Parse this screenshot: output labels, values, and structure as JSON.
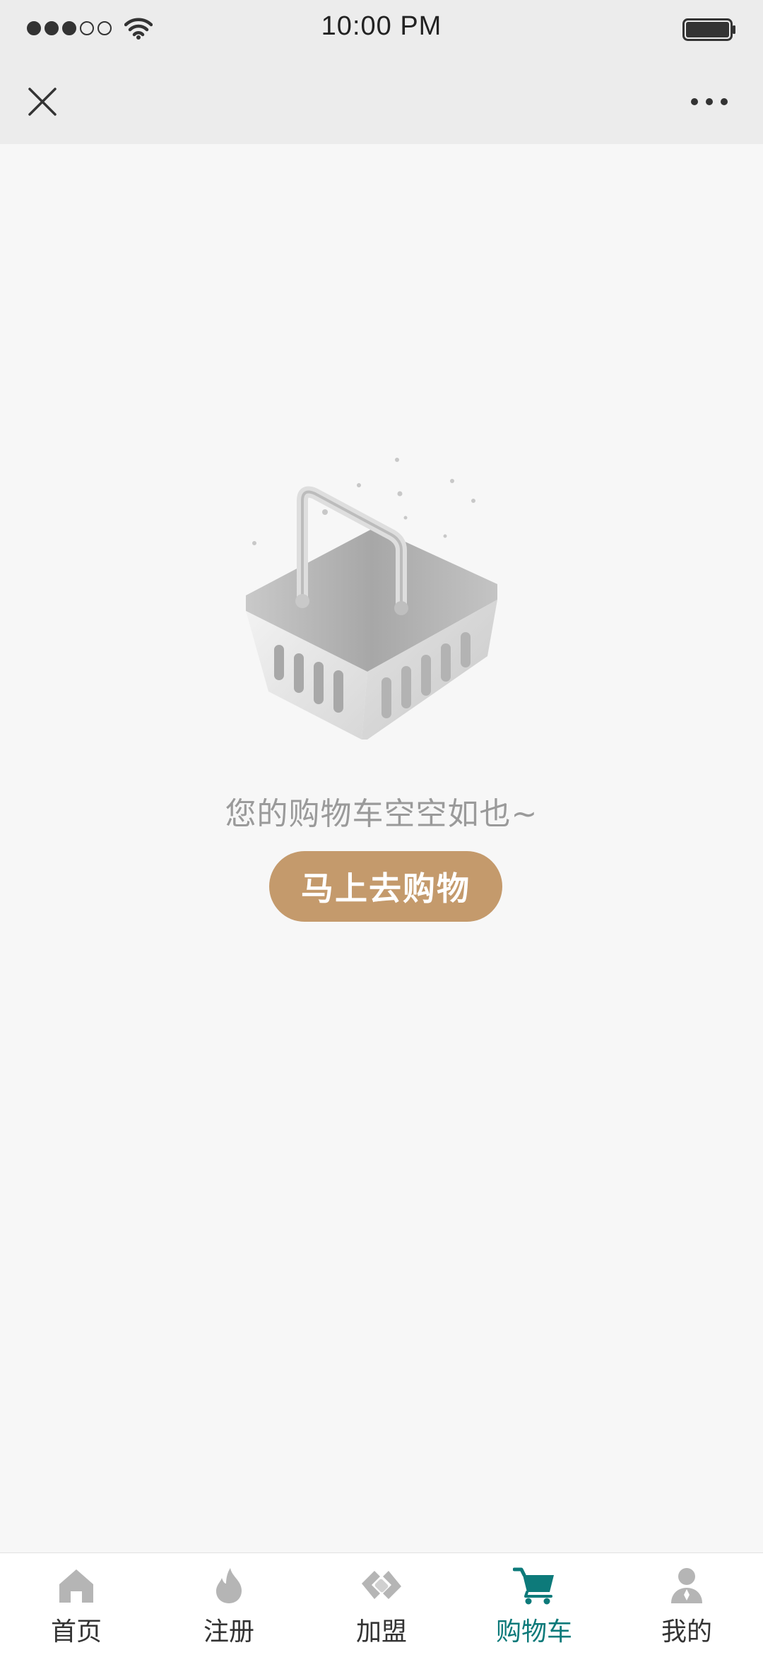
{
  "status_bar": {
    "time": "10:00 PM",
    "signal_bars": 3,
    "signal_total": 5,
    "wifi_icon": "wifi-icon",
    "battery_icon": "battery-icon"
  },
  "nav_bar": {
    "close_icon": "close-icon",
    "more_icon": "more-dots-icon"
  },
  "main": {
    "illustration": "empty-basket-illustration",
    "empty_message": "您的购物车空空如也~",
    "shop_button_label": "马上去购物"
  },
  "tab_bar": {
    "items": [
      {
        "label": "首页",
        "icon": "home-icon",
        "active": false
      },
      {
        "label": "注册",
        "icon": "flame-icon",
        "active": false
      },
      {
        "label": "加盟",
        "icon": "handshake-icon",
        "active": false
      },
      {
        "label": "购物车",
        "icon": "cart-icon",
        "active": true
      },
      {
        "label": "我的",
        "icon": "person-icon",
        "active": false
      }
    ]
  },
  "colors": {
    "accent": "#c49a6c",
    "active_tab": "#0d7a7a",
    "inactive_icon": "#b5b5b5",
    "header_bg": "#ececec",
    "page_bg": "#f7f7f7"
  }
}
